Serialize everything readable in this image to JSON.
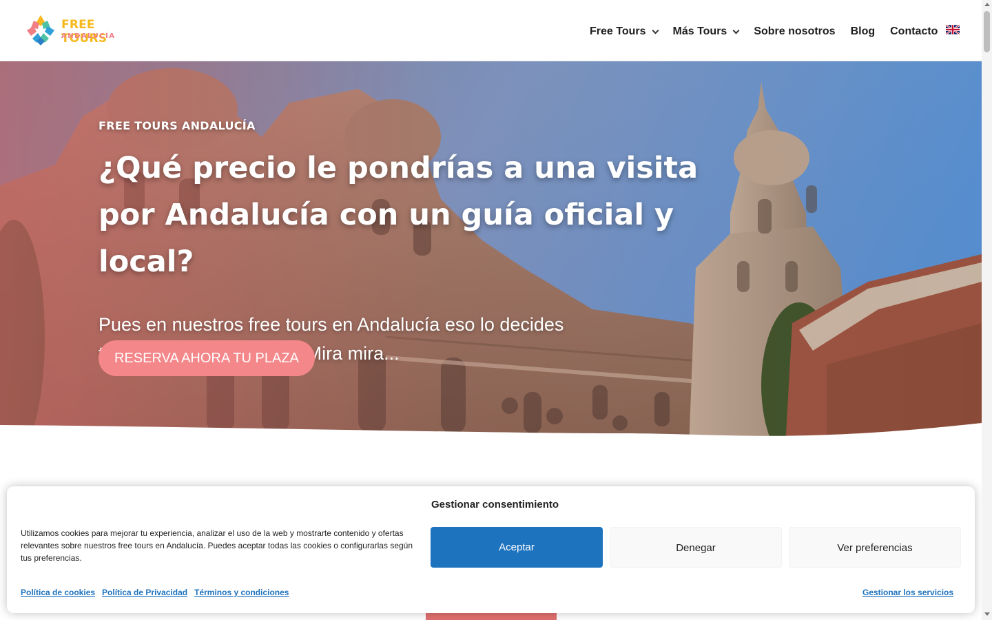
{
  "logo": {
    "line1": "FREE TOURS",
    "line2": "ANDALUCÍA"
  },
  "nav": {
    "items": [
      {
        "label": "Free Tours",
        "dropdown": true
      },
      {
        "label": "Más Tours",
        "dropdown": true
      },
      {
        "label": "Sobre nosotros",
        "dropdown": false
      },
      {
        "label": "Blog",
        "dropdown": false
      },
      {
        "label": "Contacto",
        "dropdown": false
      }
    ],
    "language_icon": "uk-flag-icon"
  },
  "hero": {
    "eyebrow": "FREE TOURS ANDALUCÍA",
    "title": "¿Qué precio le pondrías a una visita por Andalucía con un guía oficial y local?",
    "subtitle": "Pues en nuestros free tours en Andalucía eso lo decides tú y al final del recorrido. Mira mira...",
    "cta": "RESERVA AHORA TU PLAZA"
  },
  "cookie": {
    "title": "Gestionar consentimiento",
    "text": "Utilizamos cookies para mejorar tu experiencia, analizar el uso de la web y mostrarte contenido y ofertas relevantes sobre nuestros free tours en Andalucía. Puedes aceptar todas las cookies o configurarlas según tus preferencias.",
    "accept": "Aceptar",
    "deny": "Denegar",
    "preferences": "Ver preferencias",
    "links": [
      "Política de cookies",
      "Política de Privacidad",
      "Términos y condiciones"
    ],
    "manage": "Gestionar los servicios"
  },
  "colors": {
    "accent": "#f4878a",
    "primary_button": "#1e73be",
    "logo_yellow": "#f6b81c",
    "logo_pink": "#f07f86"
  }
}
